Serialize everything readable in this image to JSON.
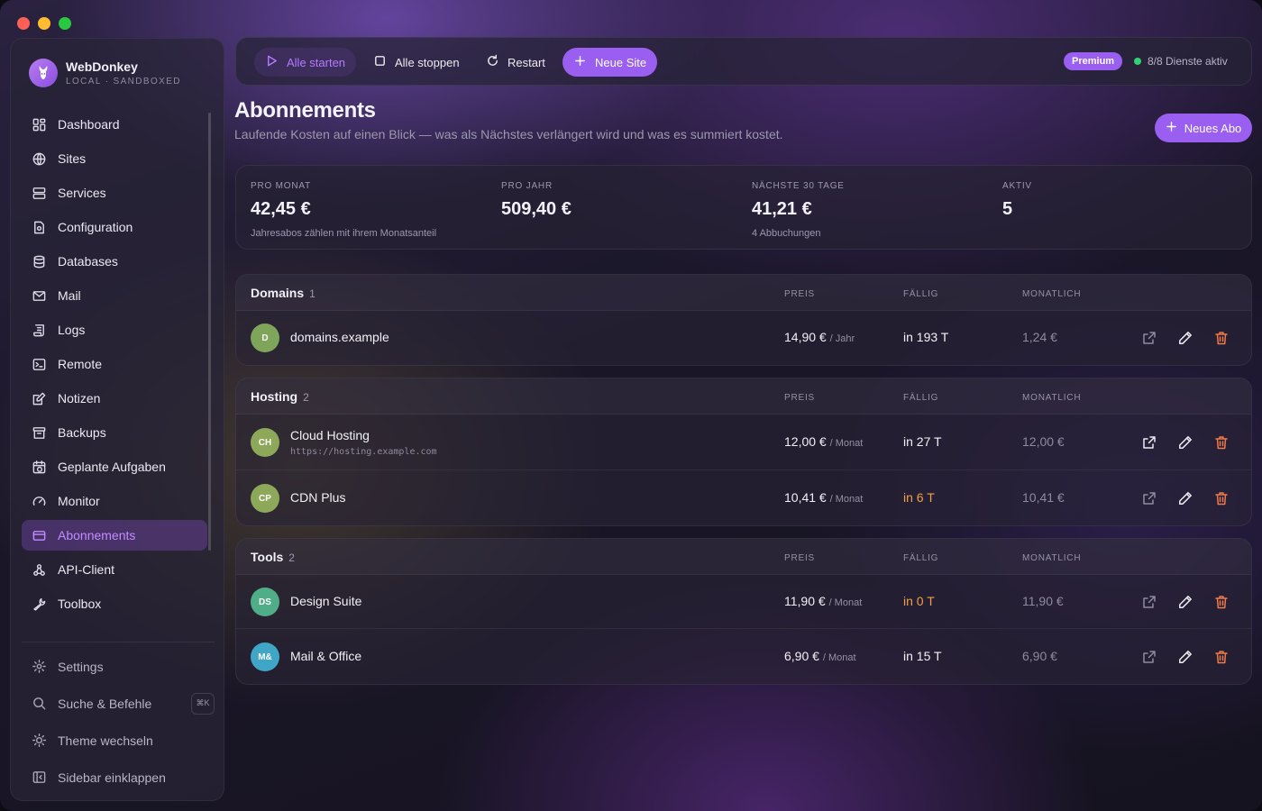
{
  "app": {
    "name": "WebDonkey",
    "subtitle": "LOCAL · SANDBOXED"
  },
  "sidebar": {
    "items": [
      {
        "label": "Dashboard",
        "icon": "dashboard-icon"
      },
      {
        "label": "Sites",
        "icon": "globe-icon"
      },
      {
        "label": "Services",
        "icon": "server-icon"
      },
      {
        "label": "Configuration",
        "icon": "file-settings-icon"
      },
      {
        "label": "Databases",
        "icon": "database-icon"
      },
      {
        "label": "Mail",
        "icon": "mail-icon"
      },
      {
        "label": "Logs",
        "icon": "scroll-icon"
      },
      {
        "label": "Remote",
        "icon": "terminal-icon"
      },
      {
        "label": "Notizen",
        "icon": "note-icon"
      },
      {
        "label": "Backups",
        "icon": "archive-icon"
      },
      {
        "label": "Geplante Aufgaben",
        "icon": "calendar-clock-icon"
      },
      {
        "label": "Monitor",
        "icon": "gauge-icon"
      },
      {
        "label": "Abonnements",
        "icon": "credit-card-icon",
        "active": true
      },
      {
        "label": "API-Client",
        "icon": "webhook-icon"
      },
      {
        "label": "Toolbox",
        "icon": "wrench-icon"
      }
    ],
    "footer": [
      {
        "label": "Settings",
        "icon": "gear-icon"
      },
      {
        "label": "Suche & Befehle",
        "icon": "search-icon",
        "shortcut": "⌘K"
      },
      {
        "label": "Theme wechseln",
        "icon": "sun-icon"
      },
      {
        "label": "Sidebar einklappen",
        "icon": "sidebar-collapse-icon"
      }
    ]
  },
  "toolbar": {
    "start_all": "Alle starten",
    "stop_all": "Alle stoppen",
    "restart": "Restart",
    "new_site": "Neue Site",
    "badge": "Premium",
    "status": "8/8 Dienste aktiv"
  },
  "page": {
    "title": "Abonnements",
    "subtitle": "Laufende Kosten auf einen Blick — was als Nächstes verlängert wird und was es summiert kostet.",
    "new_button": "Neues Abo"
  },
  "stats": [
    {
      "label": "PRO MONAT",
      "value": "42,45 €",
      "note": "Jahresabos zählen mit ihrem Monatsanteil"
    },
    {
      "label": "PRO JAHR",
      "value": "509,40 €",
      "note": ""
    },
    {
      "label": "NÄCHSTE 30 TAGE",
      "value": "41,21 €",
      "note": "4 Abbuchungen"
    },
    {
      "label": "AKTIV",
      "value": "5",
      "note": ""
    }
  ],
  "columns": {
    "price": "PREIS",
    "due": "FÄLLIG",
    "monthly": "MONATLICH"
  },
  "groups": [
    {
      "name": "Domains",
      "count": "1",
      "rows": [
        {
          "initials": "D",
          "color": "#7fa55a",
          "name": "domains.example",
          "url": "",
          "price": "14,90 €",
          "unit": "/ Jahr",
          "due": "in 193 T",
          "warn": false,
          "monthly": "1,24 €"
        }
      ]
    },
    {
      "name": "Hosting",
      "count": "2",
      "rows": [
        {
          "initials": "CH",
          "color": "#8ea85a",
          "name": "Cloud Hosting",
          "url": "https://hosting.example.com",
          "price": "12,00 €",
          "unit": "/ Monat",
          "due": "in 27 T",
          "warn": false,
          "monthly": "12,00 €"
        },
        {
          "initials": "CP",
          "color": "#8ea85a",
          "name": "CDN Plus",
          "url": "",
          "price": "10,41 €",
          "unit": "/ Monat",
          "due": "in 6 T",
          "warn": true,
          "monthly": "10,41 €"
        }
      ]
    },
    {
      "name": "Tools",
      "count": "2",
      "rows": [
        {
          "initials": "DS",
          "color": "#4fae88",
          "name": "Design Suite",
          "url": "",
          "price": "11,90 €",
          "unit": "/ Monat",
          "due": "in 0 T",
          "warn": true,
          "monthly": "11,90 €"
        },
        {
          "initials": "M&",
          "color": "#3fa6c8",
          "name": "Mail & Office",
          "url": "",
          "price": "6,90 €",
          "unit": "/ Monat",
          "due": "in 15 T",
          "warn": false,
          "monthly": "6,90 €"
        }
      ]
    }
  ],
  "colors": {
    "accent": "#9a5ff0",
    "warning": "#f0a04a",
    "danger": "#f07a4a",
    "success": "#34d074"
  }
}
